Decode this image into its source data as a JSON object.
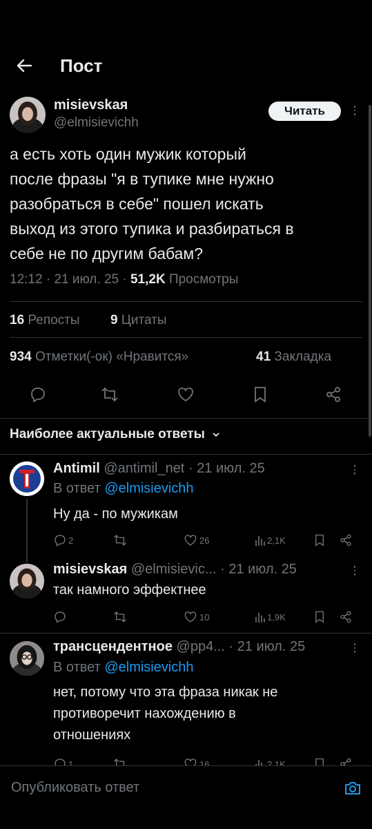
{
  "header": {
    "title": "Пост"
  },
  "post": {
    "author_name": "misievskaя",
    "author_handle": "@elmisievichh",
    "follow_label": "Читать",
    "text_lines": [
      "а есть хоть один мужик который",
      "после фразы \"я в тупике мне нужно",
      "разобраться в себе\" пошел искать",
      "выход из этого тупика и разбираться в",
      "себе не по другим бабам?"
    ],
    "time": "12:12",
    "date": "21 июл. 25",
    "views_count": "51,2K",
    "views_label": "Просмотры",
    "reposts_count": "16",
    "reposts_label": "Репосты",
    "quotes_count": "9",
    "quotes_label": "Цитаты",
    "likes_count": "934",
    "likes_label": "Отметки(-ок) «Нравится»",
    "bookmarks_count": "41",
    "bookmarks_label": "Закладка"
  },
  "replies_header": {
    "label": "Наиболее актуальные ответы"
  },
  "replies": [
    {
      "name": "Antimil",
      "handle": "@antimil_net",
      "date": "21 июл. 25",
      "reply_to_prefix": "В ответ",
      "reply_to_handle": "@elmisievichh",
      "text": "Ну да - по мужикам",
      "comments": "2",
      "likes": "26",
      "views": "2,1K"
    },
    {
      "name": "misievskaя",
      "handle": "@elmisievic...",
      "date": "21 июл. 25",
      "text": "так намного эффектнее",
      "likes": "10",
      "views": "1,9K"
    },
    {
      "name": "трансцендентное",
      "handle": "@pp4...",
      "date": "21 июл. 25",
      "reply_to_prefix": "В ответ",
      "reply_to_handle": "@elmisievichh",
      "text_lines": [
        "нет, потому что эта фраза никак не",
        "противоречит нахождению в",
        "отношениях"
      ],
      "comments": "1",
      "likes": "16",
      "views": "2,1K"
    }
  ],
  "composer": {
    "placeholder": "Опубликовать ответ"
  }
}
